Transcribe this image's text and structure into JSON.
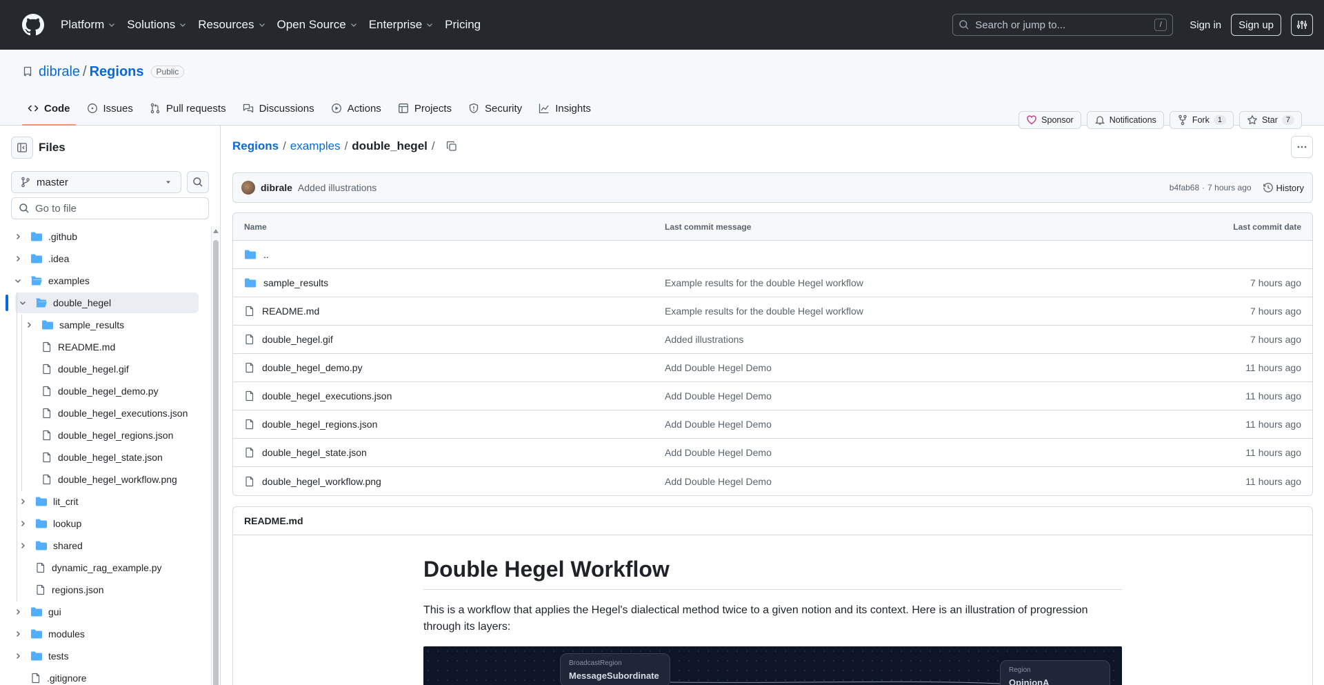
{
  "header": {
    "nav": [
      "Platform",
      "Solutions",
      "Resources",
      "Open Source",
      "Enterprise",
      "Pricing"
    ],
    "search_placeholder": "Search or jump to...",
    "search_kbd": "/",
    "signin": "Sign in",
    "signup": "Sign up"
  },
  "repo": {
    "owner": "dibrale",
    "sep": "/",
    "name": "Regions",
    "visibility": "Public",
    "sponsor": "Sponsor",
    "notifications": "Notifications",
    "fork_label": "Fork",
    "fork_count": "1",
    "star_label": "Star",
    "star_count": "7",
    "tabs": [
      "Code",
      "Issues",
      "Pull requests",
      "Discussions",
      "Actions",
      "Projects",
      "Security",
      "Insights"
    ]
  },
  "sidebar": {
    "title": "Files",
    "branch": "master",
    "goto_placeholder": "Go to file",
    "tree": [
      {
        "label": ".github",
        "type": "folder",
        "depth": 0,
        "chev": "right"
      },
      {
        "label": ".idea",
        "type": "folder",
        "depth": 0,
        "chev": "right"
      },
      {
        "label": "examples",
        "type": "folder-open",
        "depth": 0,
        "chev": "down"
      },
      {
        "label": "double_hegel",
        "type": "folder-open",
        "depth": 1,
        "chev": "down",
        "selected": true
      },
      {
        "label": "sample_results",
        "type": "folder",
        "depth": 2,
        "chev": "right"
      },
      {
        "label": "README.md",
        "type": "file",
        "depth": 2
      },
      {
        "label": "double_hegel.gif",
        "type": "file",
        "depth": 2
      },
      {
        "label": "double_hegel_demo.py",
        "type": "file",
        "depth": 2
      },
      {
        "label": "double_hegel_executions.json",
        "type": "file",
        "depth": 2
      },
      {
        "label": "double_hegel_regions.json",
        "type": "file",
        "depth": 2
      },
      {
        "label": "double_hegel_state.json",
        "type": "file",
        "depth": 2
      },
      {
        "label": "double_hegel_workflow.png",
        "type": "file",
        "depth": 2
      },
      {
        "label": "lit_crit",
        "type": "folder",
        "depth": 1,
        "chev": "right"
      },
      {
        "label": "lookup",
        "type": "folder",
        "depth": 1,
        "chev": "right"
      },
      {
        "label": "shared",
        "type": "folder",
        "depth": 1,
        "chev": "right"
      },
      {
        "label": "dynamic_rag_example.py",
        "type": "file",
        "depth": 1
      },
      {
        "label": "regions.json",
        "type": "file",
        "depth": 1
      },
      {
        "label": "gui",
        "type": "folder",
        "depth": 0,
        "chev": "right"
      },
      {
        "label": "modules",
        "type": "folder",
        "depth": 0,
        "chev": "right"
      },
      {
        "label": "tests",
        "type": "folder",
        "depth": 0,
        "chev": "right"
      },
      {
        "label": ".gitignore",
        "type": "file",
        "depth": 0
      }
    ]
  },
  "main": {
    "breadcrumb": {
      "root": "Regions",
      "mid": "examples",
      "current": "double_hegel",
      "sep": "/"
    },
    "commit": {
      "author": "dibrale",
      "message": "Added illustrations",
      "hash": "b4fab68",
      "dot": "·",
      "time": "7 hours ago",
      "history": "History"
    },
    "table": {
      "headers": [
        "Name",
        "Last commit message",
        "Last commit date"
      ],
      "parent": "..",
      "rows": [
        {
          "name": "sample_results",
          "type": "folder",
          "msg": "Example results for the double Hegel workflow",
          "date": "7 hours ago"
        },
        {
          "name": "README.md",
          "type": "file",
          "msg": "Example results for the double Hegel workflow",
          "date": "7 hours ago"
        },
        {
          "name": "double_hegel.gif",
          "type": "file",
          "msg": "Added illustrations",
          "date": "7 hours ago"
        },
        {
          "name": "double_hegel_demo.py",
          "type": "file",
          "msg": "Add Double Hegel Demo",
          "date": "11 hours ago"
        },
        {
          "name": "double_hegel_executions.json",
          "type": "file",
          "msg": "Add Double Hegel Demo",
          "date": "11 hours ago"
        },
        {
          "name": "double_hegel_regions.json",
          "type": "file",
          "msg": "Add Double Hegel Demo",
          "date": "11 hours ago"
        },
        {
          "name": "double_hegel_state.json",
          "type": "file",
          "msg": "Add Double Hegel Demo",
          "date": "11 hours ago"
        },
        {
          "name": "double_hegel_workflow.png",
          "type": "file",
          "msg": "Add Double Hegel Demo",
          "date": "11 hours ago"
        }
      ]
    },
    "readme": {
      "filename": "README.md",
      "title": "Double Hegel Workflow",
      "intro": "This is a workflow that applies the Hegel's dialectical method twice to a given notion and its context. Here is an illustration of progression through its layers:",
      "illustration": {
        "node1_type": "BroadcastRegion",
        "node1_name": "MessageSubordinate",
        "node2_type": "Region",
        "node2_name": "OpinionA"
      }
    }
  }
}
